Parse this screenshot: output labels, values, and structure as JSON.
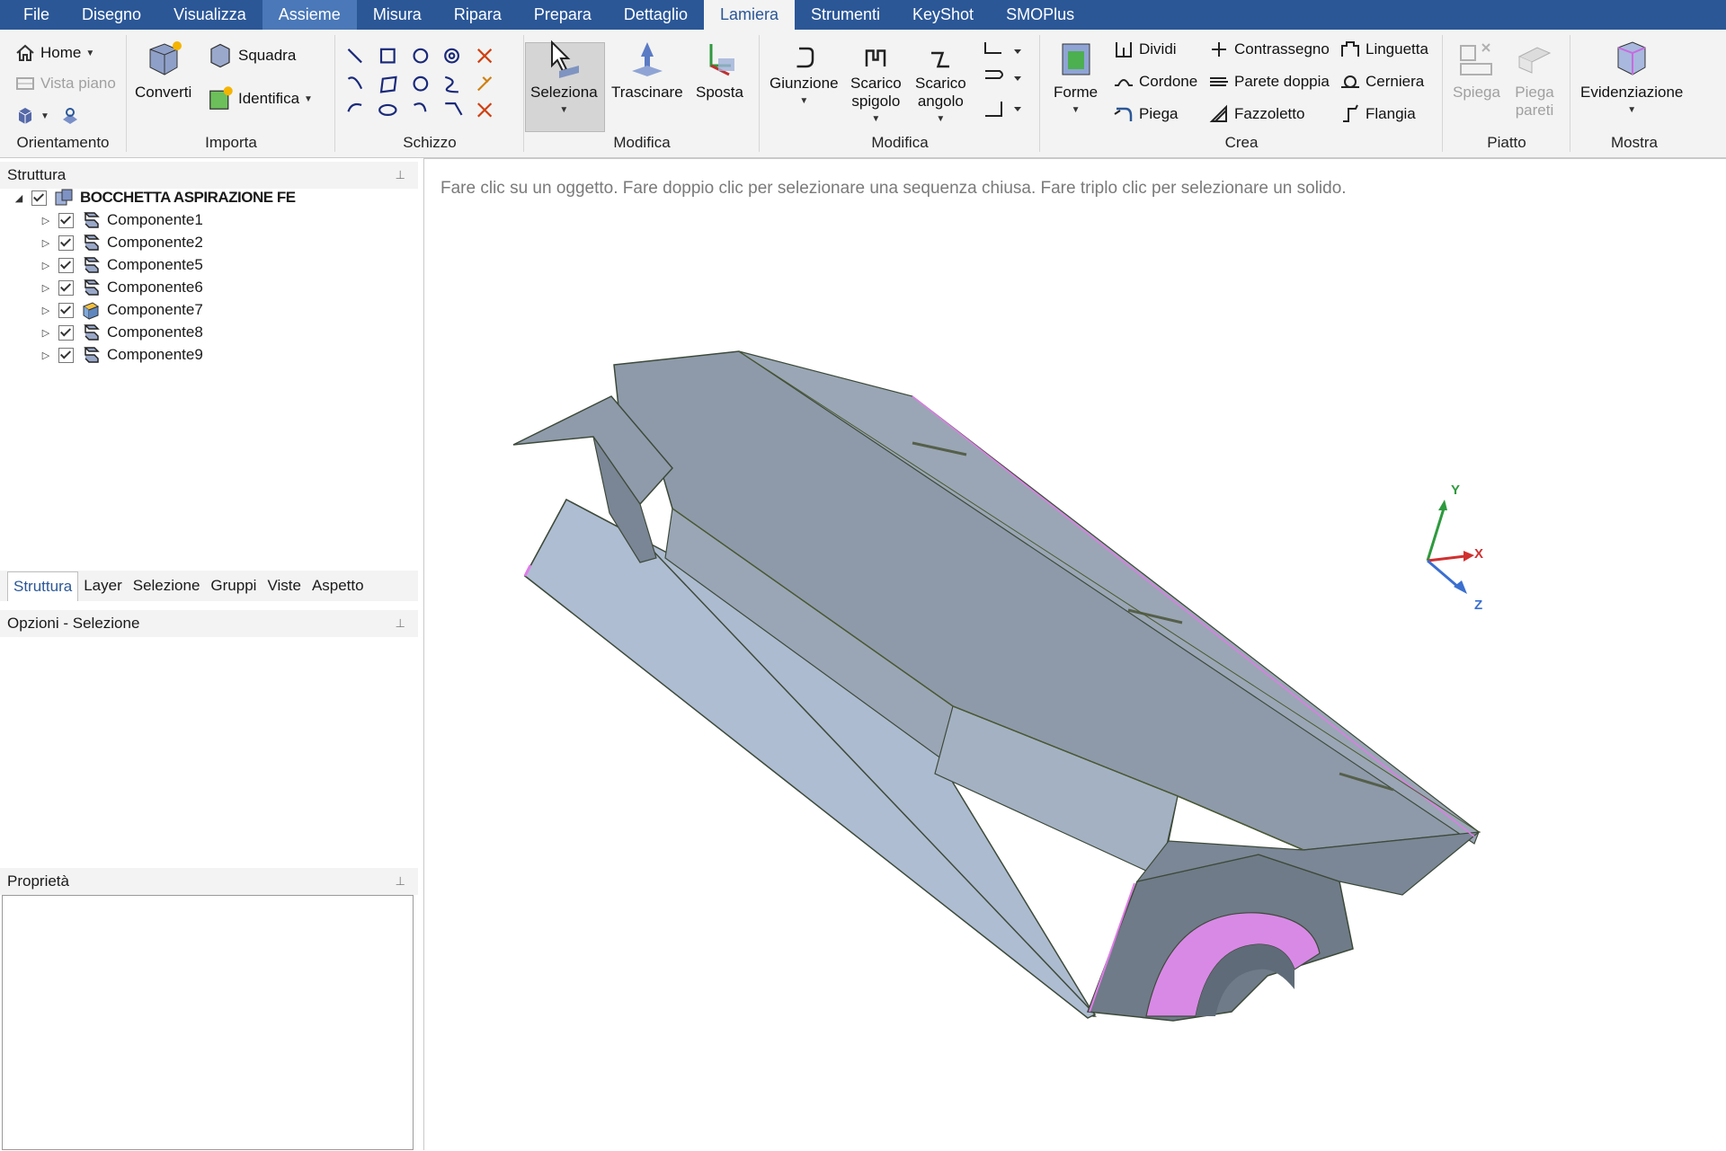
{
  "menu": {
    "tabs": [
      "File",
      "Disegno",
      "Visualizza",
      "Assieme",
      "Misura",
      "Ripara",
      "Prepara",
      "Dettaglio",
      "Lamiera",
      "Strumenti",
      "KeyShot",
      "SMOPlus"
    ],
    "active": "Lamiera",
    "hover": "Assieme"
  },
  "ribbon": {
    "orientamento": {
      "home": "Home",
      "vista_piano": "Vista piano",
      "label": "Orientamento"
    },
    "importa": {
      "converti": "Converti",
      "squadra": "Squadra",
      "identifica": "Identifica",
      "label": "Importa"
    },
    "schizzo": {
      "label": "Schizzo"
    },
    "modifica1": {
      "seleziona": "Seleziona",
      "trascinare": "Trascinare",
      "sposta": "Sposta",
      "label": "Modifica"
    },
    "modifica2": {
      "giunzione": "Giunzione",
      "scarico_spigolo": "Scarico\nspigolo",
      "scarico_angolo": "Scarico\nangolo",
      "label": "Modifica"
    },
    "crea": {
      "forme": "Forme",
      "dividi": "Dividi",
      "cordone": "Cordone",
      "piega": "Piega",
      "contrassegno": "Contrassegno",
      "parete_doppia": "Parete doppia",
      "fazzoletto": "Fazzoletto",
      "linguetta": "Linguetta",
      "cerniera": "Cerniera",
      "flangia": "Flangia",
      "label": "Crea"
    },
    "piatto": {
      "spiega": "Spiega",
      "piega_pareti": "Piega\npareti",
      "label": "Piatto"
    },
    "mostra": {
      "evidenziazione": "Evidenziazione",
      "label": "Mostra"
    }
  },
  "structure": {
    "title": "Struttura",
    "root": "BOCCHETTA ASPIRAZIONE FE",
    "items": [
      "Componente1",
      "Componente2",
      "Componente5",
      "Componente6",
      "Componente7",
      "Componente8",
      "Componente9"
    ]
  },
  "bottom_tabs": [
    "Struttura",
    "Layer",
    "Selezione",
    "Gruppi",
    "Viste",
    "Aspetto"
  ],
  "options_title": "Opzioni - Selezione",
  "properties_title": "Proprietà",
  "viewport": {
    "hint": "Fare clic su un oggetto. Fare doppio clic per selezionare una sequenza chiusa. Fare triplo clic per selezionare un solido.",
    "axes": {
      "x": "X",
      "y": "Y",
      "z": "Z"
    }
  },
  "colors": {
    "menubar": "#2b5797",
    "ribbon": "#f3f3f3",
    "part_top": "#8e9aaa",
    "part_side": "#adbbd0",
    "part_dark": "#6f7b88",
    "edge_highlight": "#e07be8"
  }
}
